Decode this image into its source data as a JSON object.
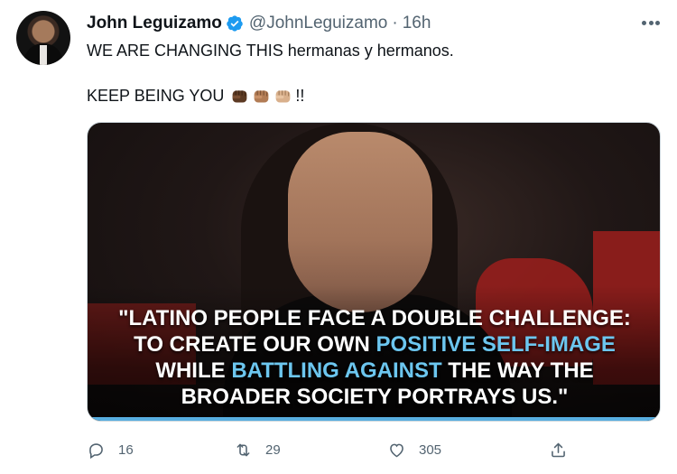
{
  "author": {
    "name": "John Leguizamo",
    "handle": "@JohnLeguizamo",
    "separator": "·",
    "time": "16h",
    "verified": true
  },
  "tweet": {
    "line1": "WE ARE CHANGING THIS hermanas y hermanos.",
    "line2_text": "KEEP BEING YOU",
    "fist_emojis": [
      "fist-dark-skin",
      "fist-medium-skin",
      "fist-light-skin"
    ],
    "line2_suffix": "!!"
  },
  "media": {
    "quote_lines": [
      [
        "\"LATINO PEOPLE FACE A DOUBLE CHALLENGE:"
      ],
      [
        "TO CREATE OUR OWN ",
        "POSITIVE SELF-IMAGE"
      ],
      [
        "WHILE ",
        "BATTLING AGAINST",
        " THE WAY THE"
      ],
      [
        "BROADER SOCIETY PORTRAYS US.\""
      ]
    ],
    "quote": {
      "l1": "\"LATINO PEOPLE FACE A DOUBLE CHALLENGE:",
      "l2a": "TO CREATE OUR OWN ",
      "l2b": "POSITIVE SELF-IMAGE",
      "l3a": "WHILE ",
      "l3b": "BATTLING AGAINST",
      "l3c": " THE WAY THE",
      "l4": "BROADER SOCIETY PORTRAYS US.\""
    },
    "highlight_color": "#6cc6ef"
  },
  "actions": {
    "reply_count": "16",
    "retweet_count": "29",
    "like_count": "305"
  },
  "colors": {
    "verified": "#1d9bf0",
    "secondary_text": "#536471"
  }
}
